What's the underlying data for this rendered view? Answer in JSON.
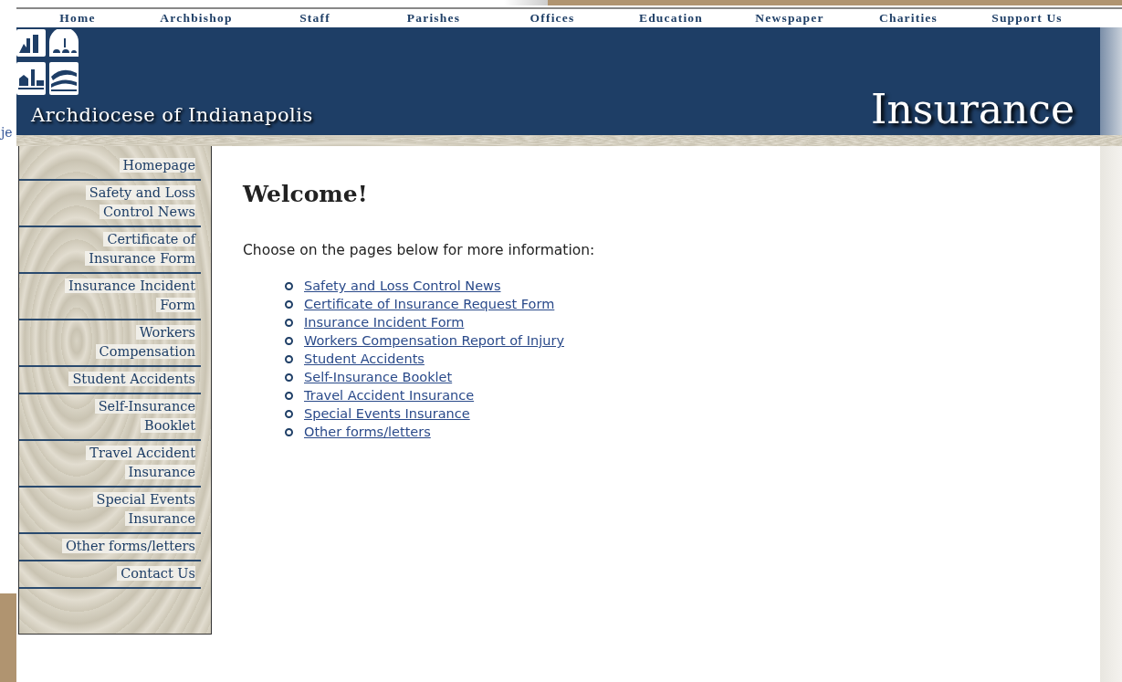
{
  "background_fragment": "je",
  "top_nav": [
    {
      "label": "Home"
    },
    {
      "label": "Archbishop"
    },
    {
      "label": "Staff"
    },
    {
      "label": "Parishes"
    },
    {
      "label": "Offices"
    },
    {
      "label": "Education"
    },
    {
      "label": "Newspaper"
    },
    {
      "label": "Charities"
    },
    {
      "label": "Support Us"
    }
  ],
  "banner": {
    "site_name": "Archdiocese of Indianapolis",
    "section_title": "Insurance"
  },
  "sidebar": {
    "items": [
      {
        "label": "Homepage"
      },
      {
        "label": "Safety and Loss Control News"
      },
      {
        "label": "Certificate of Insurance Form"
      },
      {
        "label": "Insurance Incident Form"
      },
      {
        "label": "Workers Compensation"
      },
      {
        "label": "Student Accidents"
      },
      {
        "label": "Self-Insurance Booklet"
      },
      {
        "label": "Travel Accident Insurance"
      },
      {
        "label": "Special Events Insurance"
      },
      {
        "label": "Other forms/letters"
      },
      {
        "label": "Contact Us"
      }
    ]
  },
  "main": {
    "heading": "Welcome!",
    "intro": "Choose on the pages below for more information:",
    "links": [
      "Safety and Loss Control News",
      "Certificate of Insurance Request Form",
      "Insurance Incident Form",
      "Workers Compensation Report of Injury",
      "Student Accidents",
      "Self-Insurance Booklet",
      "Travel Accident Insurance",
      "Special Events Insurance",
      "Other forms/letters"
    ]
  }
}
